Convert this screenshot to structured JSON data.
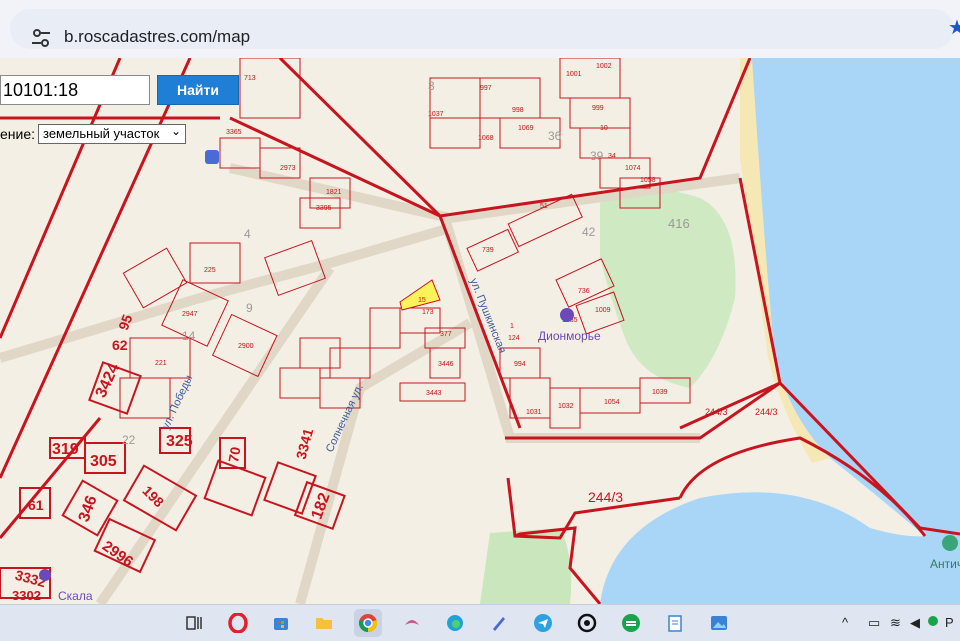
{
  "browser": {
    "url": "b.roscadastres.com/map"
  },
  "search": {
    "value": "10101:18",
    "button_label": "Найти",
    "type_label": "ение:",
    "type_selected": "земельный участок"
  },
  "map": {
    "street_labels": [
      "ул. Победы",
      "Солнечная ул.",
      "ул. Пушкинская"
    ],
    "poi_labels": [
      "Дионморье",
      "Античное городище",
      "Скала"
    ],
    "parcel_labels": {
      "p3424": "3424",
      "p62": "62",
      "p95": "95",
      "p319": "319",
      "p305": "305",
      "p325": "325",
      "p70": "70",
      "p198": "198",
      "p346": "346",
      "p61": "61",
      "p2996": "2996",
      "p3332": "3332",
      "p3302": "3302",
      "p182": "182",
      "p3341": "3341",
      "p244": "244/3",
      "p244b": "244/3",
      "p244c": "244/3",
      "p416": "416",
      "p22": "22",
      "p14": "14",
      "p9": "9",
      "p4": "4",
      "p3": "3",
      "p36": "36",
      "p39": "39",
      "p42": "42",
      "p713": "713",
      "p1001": "1001",
      "p1002": "1002",
      "p997": "997",
      "p998": "998",
      "p1037": "1037",
      "p1069": "1069",
      "p1068": "1068",
      "p999": "999",
      "p10": "10",
      "p34": "34",
      "p1074": "1074",
      "p1058": "1058",
      "p3365": "3365",
      "p2973": "2973",
      "p1821": "1821",
      "p3395": "3395",
      "p51": "51",
      "p739": "739",
      "p736": "736",
      "p1035": "1035",
      "p1009": "1009",
      "p225": "225",
      "p2947": "2947",
      "p2900": "2900",
      "p221": "221",
      "p3443": "3443",
      "p377": "377",
      "p3446": "3446",
      "p173": "173",
      "p15": "15",
      "p1031": "1031",
      "p1032": "1032",
      "p1054": "1054",
      "p1039": "1039",
      "p994": "994",
      "p124": "124",
      "p1": "1"
    }
  },
  "taskbar": {
    "tray_lang": "Р"
  },
  "colors": {
    "parcel_border": "#c8141e",
    "selected_parcel": "#fff35a",
    "sea": "#a9d6f7",
    "land": "#f3eee3",
    "park": "#c9ecc1",
    "accent": "#1f7ed6"
  }
}
